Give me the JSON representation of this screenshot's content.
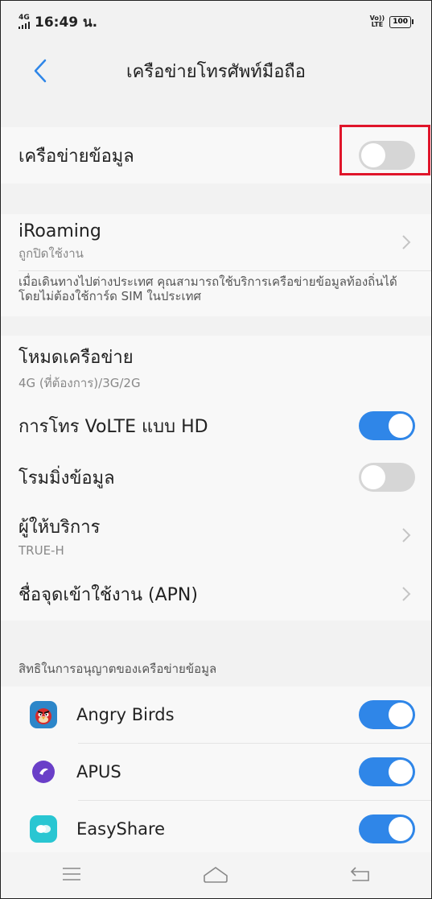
{
  "status_bar": {
    "network_type": "4G",
    "time": "16:49 น.",
    "volte": "Vo)) LTE",
    "battery": "100"
  },
  "header": {
    "title": "เครือข่ายโทรศัพท์มือถือ"
  },
  "settings": {
    "mobile_data": {
      "label": "เครือข่ายข้อมูล",
      "enabled": false
    },
    "iroaming": {
      "label": "iRoaming",
      "status": "ถูกปิดใช้งาน",
      "description": "เมื่อเดินทางไปต่างประเทศ คุณสามารถใช้บริการเครือข่ายข้อมูลท้องถิ่นได้โดยไม่ต้องใช้การ์ด SIM ในประเทศ"
    },
    "network_mode": {
      "label": "โหมดเครือข่าย",
      "value": "4G (ที่ต้องการ)/3G/2G"
    },
    "volte_hd": {
      "label": "การโทร VoLTE แบบ HD",
      "enabled": true
    },
    "data_roaming": {
      "label": "โรมมิ่งข้อมูล",
      "enabled": false
    },
    "carrier": {
      "label": "ผู้ให้บริการ",
      "value": "TRUE-H"
    },
    "apn": {
      "label": "ชื่อจุดเข้าใช้งาน (APN)"
    }
  },
  "permissions": {
    "header": "สิทธิในการอนุญาตของเครือข่ายข้อมูล",
    "apps": [
      {
        "name": "Angry Birds",
        "icon": "angry-birds-icon",
        "enabled": true
      },
      {
        "name": "APUS",
        "icon": "apus-icon",
        "enabled": true
      },
      {
        "name": "EasyShare",
        "icon": "easyshare-icon",
        "enabled": true
      }
    ]
  },
  "colors": {
    "accent": "#2f86e8",
    "toggle_off": "#d6d6d6",
    "highlight": "#e0152a"
  }
}
